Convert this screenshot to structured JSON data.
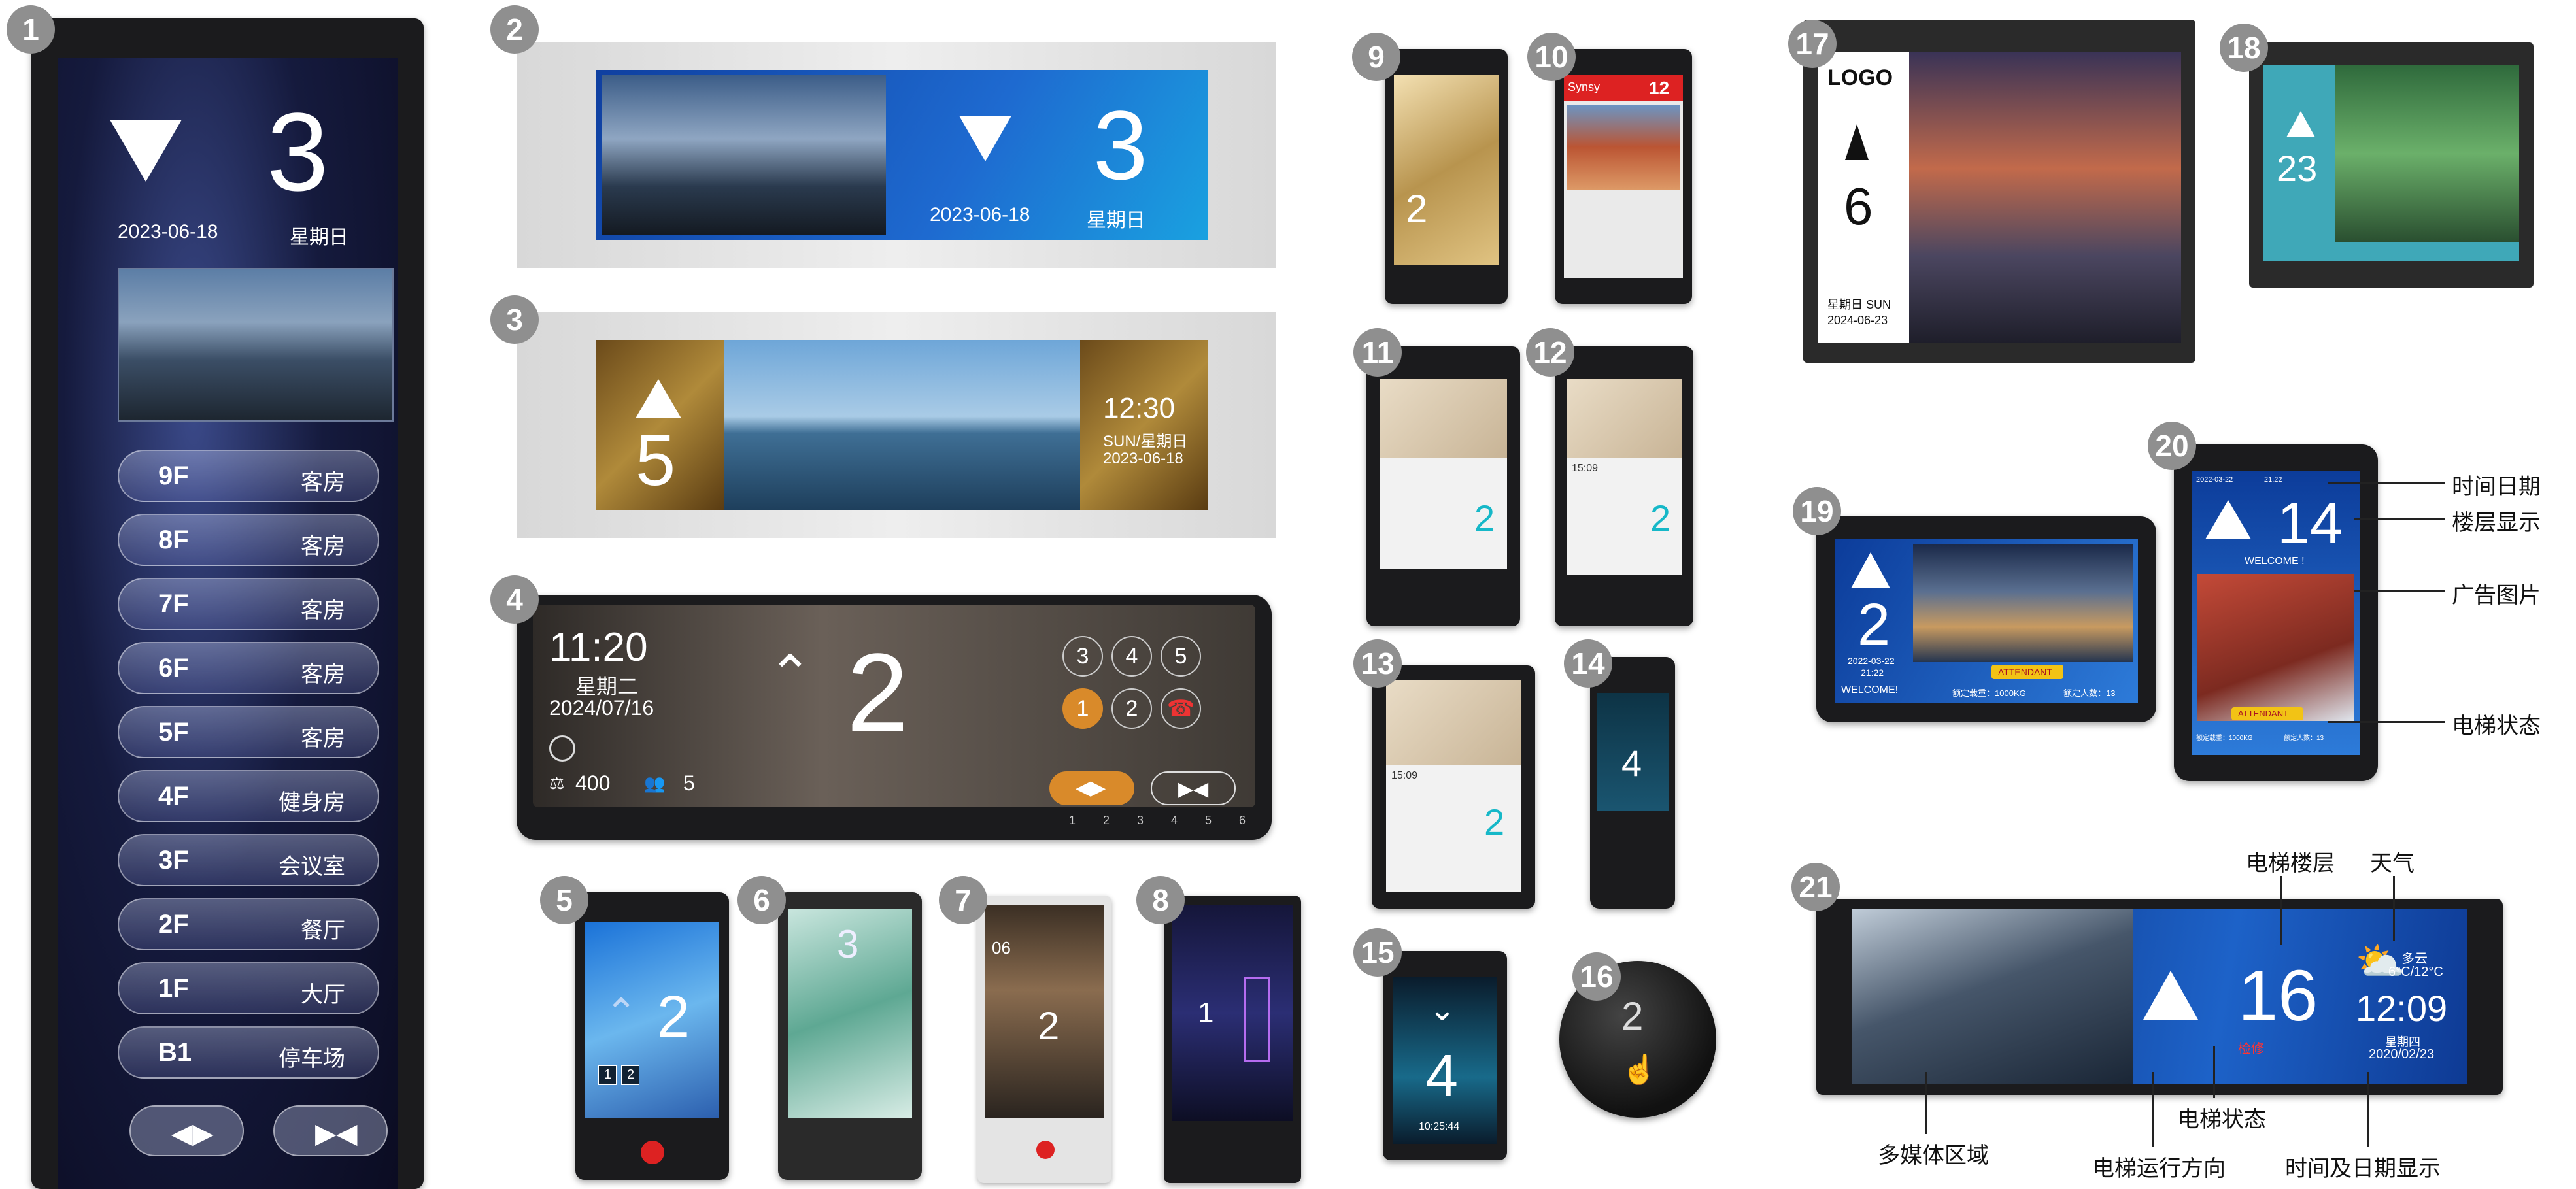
{
  "badges": [
    "1",
    "2",
    "3",
    "4",
    "5",
    "6",
    "7",
    "8",
    "9",
    "10",
    "11",
    "12",
    "13",
    "14",
    "15",
    "16",
    "17",
    "18",
    "19",
    "20",
    "21"
  ],
  "d1": {
    "floor": "3",
    "date": "2023-06-18",
    "weekday": "星期日",
    "rows": [
      {
        "f": "9F",
        "n": "客房"
      },
      {
        "f": "8F",
        "n": "客房"
      },
      {
        "f": "7F",
        "n": "客房"
      },
      {
        "f": "6F",
        "n": "客房"
      },
      {
        "f": "5F",
        "n": "客房"
      },
      {
        "f": "4F",
        "n": "健身房"
      },
      {
        "f": "3F",
        "n": "会议室"
      },
      {
        "f": "2F",
        "n": "餐厅"
      },
      {
        "f": "1F",
        "n": "大厅"
      },
      {
        "f": "B1",
        "n": "停车场"
      }
    ]
  },
  "d2": {
    "floor": "3",
    "date": "2023-06-18",
    "weekday": "星期日"
  },
  "d3": {
    "floor": "5",
    "time": "12:30",
    "day": "SUN/星期日",
    "date": "2023-06-18"
  },
  "d4": {
    "time": "11:20",
    "weekday": "星期二",
    "date": "2024/07/16",
    "floor": "2",
    "load": "400",
    "persons": "5",
    "keys": [
      "3",
      "4",
      "5",
      "1",
      "2"
    ],
    "bottom_nums": [
      "1",
      "2",
      "3",
      "4",
      "5",
      "6"
    ]
  },
  "d5": {
    "floor": "2",
    "keys": [
      "1",
      "2"
    ]
  },
  "d6": {
    "floor": "3"
  },
  "d7": {
    "floor": "2",
    "floor_small": "06"
  },
  "d8": {
    "floor": "1"
  },
  "d9": {
    "floor": "2"
  },
  "d10": {
    "brand": "Synsy",
    "floor": "12"
  },
  "d11": {
    "floor": "2"
  },
  "d12": {
    "floor": "2",
    "time": "15:09"
  },
  "d13": {
    "floor": "2",
    "time": "15:09"
  },
  "d14": {
    "floor": "4"
  },
  "d15": {
    "floor": "4",
    "time": "10:25:44"
  },
  "d16": {
    "floor": "2"
  },
  "d17": {
    "logo": "LOGO",
    "floor": "6",
    "weekday": "星期日 SUN",
    "date": "2024-06-23"
  },
  "d18": {
    "floor": "23"
  },
  "d19": {
    "floor": "2",
    "date": "2022-03-22",
    "time": "21:22",
    "welcome": "WELCOME!",
    "status": "ATTENDANT",
    "load": "额定载重：1000KG",
    "persons": "额定人数：13"
  },
  "d20": {
    "date": "2022-03-22",
    "time": "21:22",
    "floor": "14",
    "welcome": "WELCOME !",
    "status": "ATTENDANT",
    "load": "额定载重：1000KG",
    "persons": "额定人数：13",
    "callouts": [
      "时间日期",
      "楼层显示",
      "广告图片",
      "电梯状态"
    ]
  },
  "d21": {
    "floor": "16",
    "status": "检修",
    "weather": "多云",
    "temp": "6°C/12°C",
    "time": "12:09",
    "weekday": "星期四",
    "date": "2020/02/23",
    "callouts": {
      "floor": "电梯楼层",
      "weather": "天气",
      "media": "多媒体区域",
      "state": "电梯状态",
      "direction": "电梯运行方向",
      "datetime": "时间及日期显示"
    }
  },
  "colors": {
    "badge": "#8f8f8f",
    "bezel": "#1b1b1d",
    "blue": "#1f5db8",
    "gold": "#b08a3a",
    "cyan": "#27c6d8"
  }
}
